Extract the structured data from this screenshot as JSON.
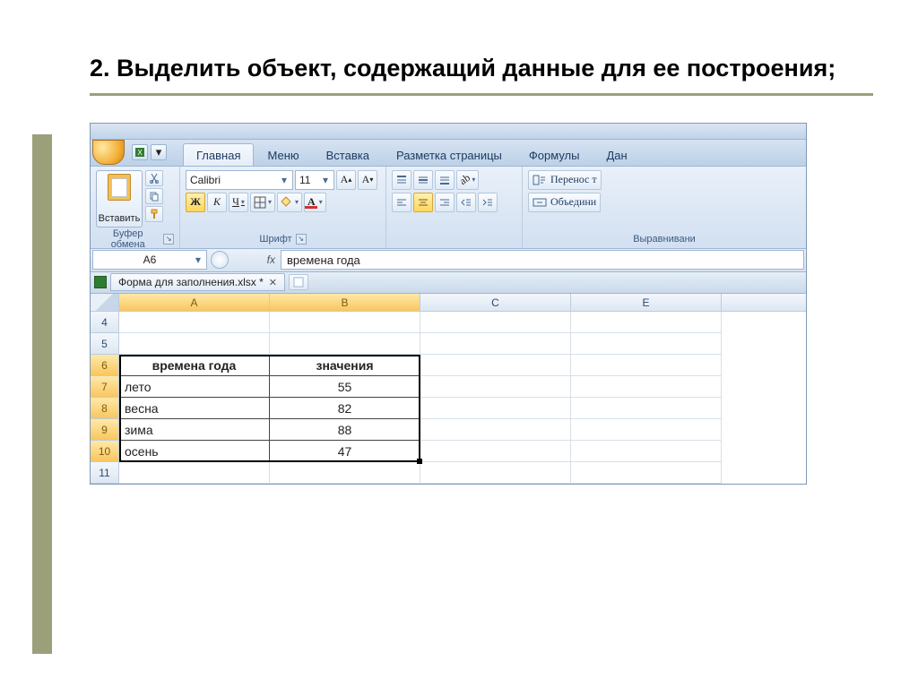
{
  "slide": {
    "title": "2. Выделить объект, содержащий данные для ее построения;"
  },
  "ribbon": {
    "tabs": {
      "home": "Главная",
      "menu": "Меню",
      "insert": "Вставка",
      "layout": "Разметка страницы",
      "formulas": "Формулы",
      "data": "Дан"
    },
    "clipboard": {
      "paste": "Вставить",
      "group_label": "Буфер обмена"
    },
    "font": {
      "family": "Calibri",
      "size": "11",
      "group_label": "Шрифт",
      "bold": "Ж",
      "italic": "К",
      "underline": "Ч"
    },
    "alignment": {
      "wrap": "Перенос т",
      "merge": "Объедини",
      "group_label": "Выравнивани"
    }
  },
  "formula_bar": {
    "name_box": "A6",
    "fx": "fx",
    "value": "времена года"
  },
  "workbook_tab": "Форма для заполнения.xlsx *",
  "columns": {
    "A": "A",
    "B": "B",
    "C": "C",
    "E": "E"
  },
  "rows": {
    "r4": "4",
    "r5": "5",
    "r6": "6",
    "r7": "7",
    "r8": "8",
    "r9": "9",
    "r10": "10",
    "r11": "11"
  },
  "table": {
    "headerA": "времена года",
    "headerB": "значения",
    "rows": [
      {
        "a": "лето",
        "b": "55"
      },
      {
        "a": "весна",
        "b": "82"
      },
      {
        "a": "зима",
        "b": "88"
      },
      {
        "a": "осень",
        "b": "47"
      }
    ]
  },
  "chart_data": {
    "type": "table",
    "categories": [
      "лето",
      "весна",
      "зима",
      "осень"
    ],
    "values": [
      55,
      82,
      88,
      47
    ],
    "title": "времена года",
    "ylabel": "значения"
  }
}
